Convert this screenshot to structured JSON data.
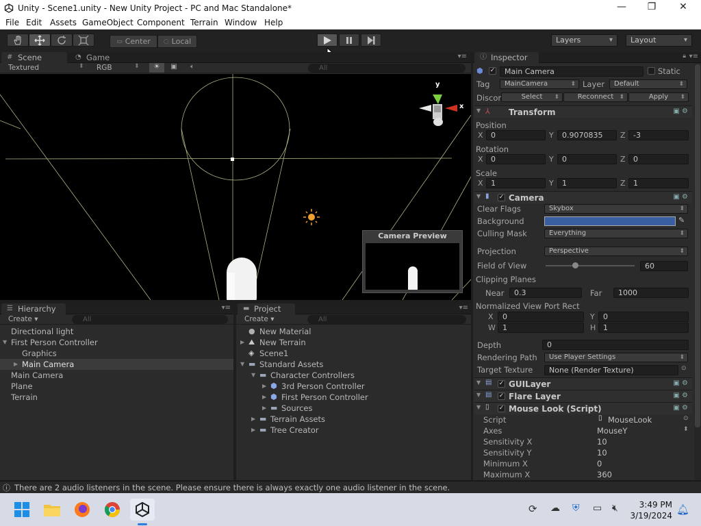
{
  "window": {
    "title": "Unity - Scene1.unity - New Unity Project - PC and Mac Standalone*",
    "minimize": "—",
    "maximize": "❐",
    "close": "✕"
  },
  "menu": [
    "File",
    "Edit",
    "Assets",
    "GameObject",
    "Component",
    "Terrain",
    "Window",
    "Help"
  ],
  "toolbar": {
    "pivot": "Center",
    "space": "Local",
    "layers": "Layers",
    "layout": "Layout"
  },
  "scene": {
    "tab_scene": "Scene",
    "tab_game": "Game",
    "render_mode": "Textured",
    "color_mode": "RGB",
    "search_placeholder": "All",
    "gizmo_y": "y",
    "gizmo_x": "x",
    "preview_title": "Camera Preview"
  },
  "hierarchy": {
    "tab": "Hierarchy",
    "create": "Create",
    "search_placeholder": "All",
    "items": [
      {
        "label": "Directional light",
        "indent": 0,
        "arrow": ""
      },
      {
        "label": "First Person Controller",
        "indent": 0,
        "arrow": "▼"
      },
      {
        "label": "Graphics",
        "indent": 1,
        "arrow": ""
      },
      {
        "label": "Main Camera",
        "indent": 1,
        "arrow": "▶",
        "selected": true
      },
      {
        "label": "Main Camera",
        "indent": 0,
        "arrow": ""
      },
      {
        "label": "Plane",
        "indent": 0,
        "arrow": ""
      },
      {
        "label": "Terrain",
        "indent": 0,
        "arrow": ""
      }
    ]
  },
  "project": {
    "tab": "Project",
    "create": "Create",
    "search_placeholder": "All",
    "items": [
      {
        "label": "New Material",
        "indent": 0,
        "arrow": "",
        "icon": "sphere-icon"
      },
      {
        "label": "New Terrain",
        "indent": 0,
        "arrow": "▶",
        "icon": "terrain-icon"
      },
      {
        "label": "Scene1",
        "indent": 0,
        "arrow": "",
        "icon": "unity-scene-icon"
      },
      {
        "label": "Standard Assets",
        "indent": 0,
        "arrow": "▼",
        "icon": "folder-icon"
      },
      {
        "label": "Character Controllers",
        "indent": 1,
        "arrow": "▼",
        "icon": "folder-icon"
      },
      {
        "label": "3rd Person Controller",
        "indent": 2,
        "arrow": "▶",
        "icon": "prefab-icon"
      },
      {
        "label": "First Person Controller",
        "indent": 2,
        "arrow": "▶",
        "icon": "prefab-icon"
      },
      {
        "label": "Sources",
        "indent": 2,
        "arrow": "▶",
        "icon": "folder-icon"
      },
      {
        "label": "Terrain Assets",
        "indent": 1,
        "arrow": "▶",
        "icon": "folder-icon"
      },
      {
        "label": "Tree Creator",
        "indent": 1,
        "arrow": "▶",
        "icon": "folder-icon"
      }
    ]
  },
  "inspector": {
    "tab": "Inspector",
    "object_name": "Main Camera",
    "static_label": "Static",
    "tag_label": "Tag",
    "tag_value": "MainCamera",
    "layer_label": "Layer",
    "layer_value": "Default",
    "prefab_label": "Discor",
    "select": "Select",
    "reconnect": "Reconnect",
    "apply": "Apply",
    "transform": {
      "title": "Transform",
      "position_label": "Position",
      "rotation_label": "Rotation",
      "scale_label": "Scale",
      "position": {
        "x": "0",
        "y": "0.9070835",
        "z": "-3"
      },
      "rotation": {
        "x": "0",
        "y": "0",
        "z": "0"
      },
      "scale": {
        "x": "1",
        "y": "1",
        "z": "1"
      }
    },
    "camera": {
      "title": "Camera",
      "clear_flags_label": "Clear Flags",
      "clear_flags": "Skybox",
      "background_label": "Background",
      "background_color": "#3a5fa0",
      "culling_label": "Culling Mask",
      "culling": "Everything",
      "projection_label": "Projection",
      "projection": "Perspective",
      "fov_label": "Field of View",
      "fov": "60",
      "fov_fraction": 0.33,
      "clipping_label": "Clipping Planes",
      "near_label": "Near",
      "near": "0.3",
      "far_label": "Far",
      "far": "1000",
      "viewport_label": "Normalized View Port Rect",
      "viewport": {
        "x": "0",
        "y": "0",
        "w": "1",
        "h": "1"
      },
      "depth_label": "Depth",
      "depth": "0",
      "rendering_label": "Rendering Path",
      "rendering": "Use Player Settings",
      "target_label": "Target Texture",
      "target": "None (Render Texture)"
    },
    "guilayer": "GUILayer",
    "flarelayer": "Flare Layer",
    "mouselook": {
      "title": "Mouse Look (Script)",
      "script_label": "Script",
      "script": "MouseLook",
      "axes_label": "Axes",
      "axes": "MouseY",
      "sensx_label": "Sensitivity X",
      "sensx": "10",
      "sensy_label": "Sensitivity Y",
      "sensy": "10",
      "minx_label": "Minimum X",
      "minx": "0",
      "maxx_label": "Maximum X",
      "maxx": "360"
    }
  },
  "status": "There are 2 audio listeners in the scene. Please ensure there is always exactly one audio listener in the scene.",
  "taskbar": {
    "time": "3:49 PM",
    "date": "3/19/2024"
  },
  "colors": {
    "accent": "#3a5fa0",
    "panel": "#2b2b2b"
  }
}
